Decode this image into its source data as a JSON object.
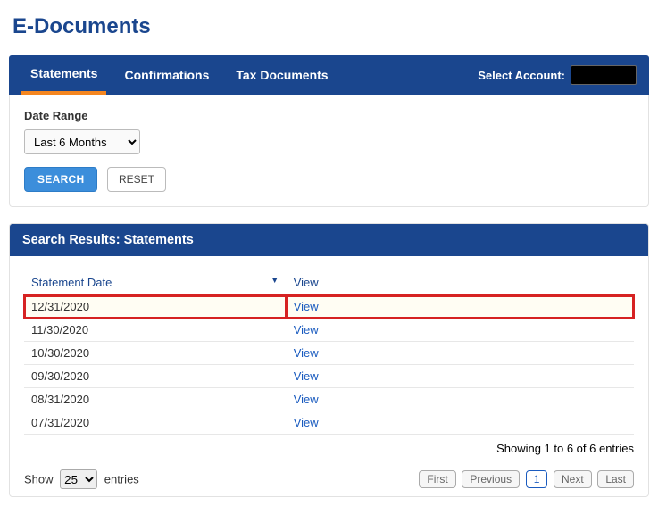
{
  "page_title": "E-Documents",
  "tabs": [
    "Statements",
    "Confirmations",
    "Tax Documents"
  ],
  "active_tab_index": 0,
  "select_account_label": "Select Account:",
  "select_account_value": "",
  "filter": {
    "label": "Date Range",
    "value": "Last 6 Months",
    "options": [
      "Last 6 Months"
    ]
  },
  "buttons": {
    "search": "SEARCH",
    "reset": "RESET"
  },
  "results_header": "Search Results: Statements",
  "columns": {
    "date": "Statement Date",
    "view": "View"
  },
  "rows": [
    {
      "date": "12/31/2020",
      "view": "View",
      "highlight": true
    },
    {
      "date": "11/30/2020",
      "view": "View"
    },
    {
      "date": "10/30/2020",
      "view": "View"
    },
    {
      "date": "09/30/2020",
      "view": "View"
    },
    {
      "date": "08/31/2020",
      "view": "View"
    },
    {
      "date": "07/31/2020",
      "view": "View"
    }
  ],
  "showing_info": "Showing 1 to 6 of 6 entries",
  "show_entries": {
    "prefix": "Show",
    "value": "25",
    "suffix": "entries"
  },
  "pager": {
    "first": "First",
    "prev": "Previous",
    "current": "1",
    "next": "Next",
    "last": "Last"
  }
}
